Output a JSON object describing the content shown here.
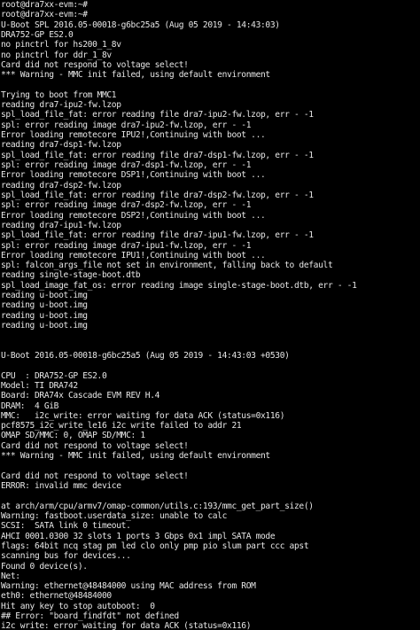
{
  "terminal": {
    "background_color": "#000000",
    "text_color": "#e6e6e6",
    "lines": [
      "root@dra7xx-evm:~#",
      "root@dra7xx-evm:~#",
      "U-Boot SPL 2016.05-00018-g6bc25a5 (Aug 05 2019 - 14:43:03)",
      "DRA752-GP ES2.0",
      "no pinctrl for hs200_1_8v",
      "no pinctrl for ddr_1_8v",
      "Card did not respond to voltage select!",
      "*** Warning - MMC init failed, using default environment",
      "",
      "Trying to boot from MMC1",
      "reading dra7-ipu2-fw.lzop",
      "spl_load_file_fat: error reading file dra7-ipu2-fw.lzop, err - -1",
      "spl: error reading image dra7-ipu2-fw.lzop, err - -1",
      "Error loading remotecore IPU2!,Continuing with boot ...",
      "reading dra7-dsp1-fw.lzop",
      "spl_load_file_fat: error reading file dra7-dsp1-fw.lzop, err - -1",
      "spl: error reading image dra7-dsp1-fw.lzop, err - -1",
      "Error loading remotecore DSP1!,Continuing with boot ...",
      "reading dra7-dsp2-fw.lzop",
      "spl_load_file_fat: error reading file dra7-dsp2-fw.lzop, err - -1",
      "spl: error reading image dra7-dsp2-fw.lzop, err - -1",
      "Error loading remotecore DSP2!,Continuing with boot ...",
      "reading dra7-ipu1-fw.lzop",
      "spl_load_file_fat: error reading file dra7-ipu1-fw.lzop, err - -1",
      "spl: error reading image dra7-ipu1-fw.lzop, err - -1",
      "Error loading remotecore IPU1!,Continuing with boot ...",
      "spl: falcon_args_file not set in environment, falling back to default",
      "reading single-stage-boot.dtb",
      "spl_load_image_fat_os: error reading image single-stage-boot.dtb, err - -1",
      "reading u-boot.img",
      "reading u-boot.img",
      "reading u-boot.img",
      "reading u-boot.img",
      "",
      "",
      "U-Boot 2016.05-00018-g6bc25a5 (Aug 05 2019 - 14:43:03 +0530)",
      "",
      "CPU  : DRA752-GP ES2.0",
      "Model: TI DRA742",
      "Board: DRA74x Cascade EVM REV H.4",
      "DRAM:  4 GiB",
      "MMC:   i2c_write: error waiting for data ACK (status=0x116)",
      "pcf8575_i2c_write_le16 i2c write failed to addr 21",
      "OMAP SD/MMC: 0, OMAP SD/MMC: 1",
      "Card did not respond to voltage select!",
      "*** Warning - MMC init failed, using default environment",
      "",
      "Card did not respond to voltage select!",
      "ERROR: invalid mmc device",
      "",
      "at arch/arm/cpu/armv7/omap-common/utils.c:193/mmc_get_part_size()",
      "Warning: fastboot.userdata_size: unable to calc",
      "SCSI:  SATA link 0 timeout.",
      "AHCI 0001.0300 32 slots 1 ports 3 Gbps 0x1 impl SATA mode",
      "flags: 64bit ncq stag pm led clo only pmp pio slum part ccc apst",
      "scanning bus for devices...",
      "Found 0 device(s).",
      "Net:",
      "Warning: ethernet@48484000 using MAC address from ROM",
      "eth0: ethernet@48484000",
      "Hit any key to stop autoboot:  0",
      "## Error: \"board_findfdt\" not defined",
      "i2c_write: error waiting for data ACK (status=0x116)"
    ]
  }
}
